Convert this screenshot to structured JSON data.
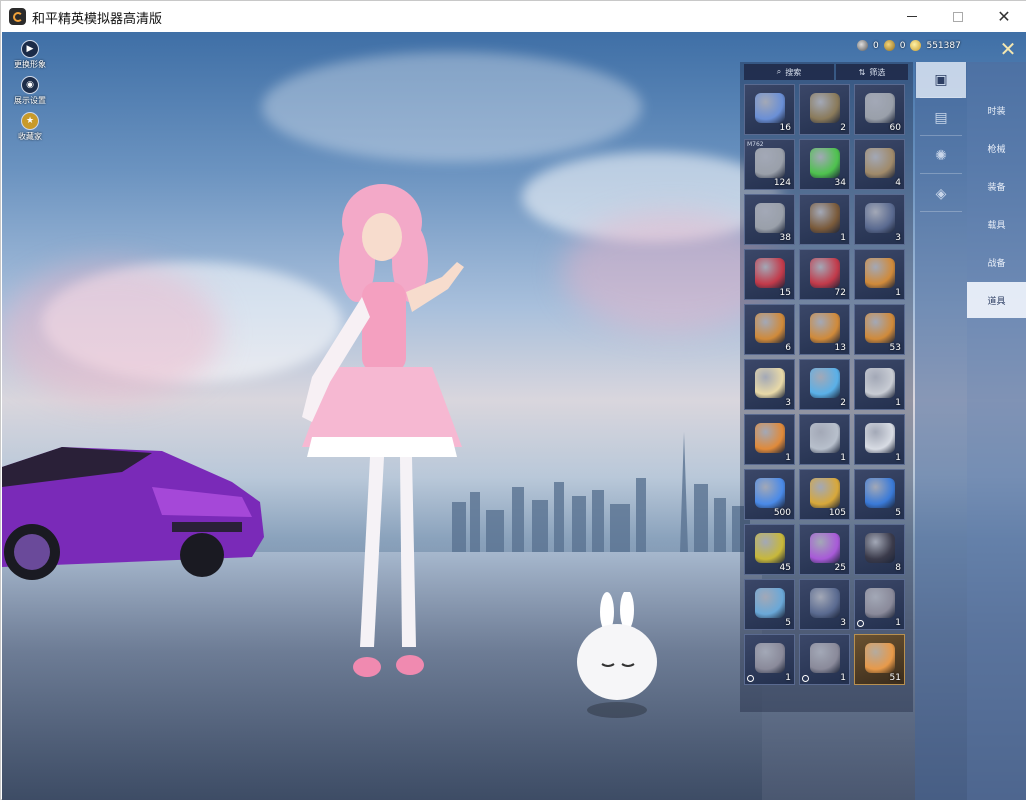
{
  "window": {
    "title": "和平精英模拟器高清版",
    "controls": {
      "minimize": "minimize",
      "maximize": "maximize",
      "close": "close"
    }
  },
  "left_tools": [
    {
      "icon": "play-icon",
      "label": "更换形象"
    },
    {
      "icon": "eye-icon",
      "label": "展示设置"
    },
    {
      "icon": "badge-icon",
      "label": "收藏家"
    }
  ],
  "currency": [
    {
      "icon": "silver-coin-icon",
      "value": "0"
    },
    {
      "icon": "gold-coin-icon",
      "value": "0"
    },
    {
      "icon": "yellow-coin-icon",
      "value": "551387"
    }
  ],
  "search": {
    "search_label": "搜索",
    "filter_label": "筛选"
  },
  "inventory": [
    {
      "name": "spray-can",
      "qty": "16",
      "tag": "",
      "clock": false,
      "color": "#6a8fd6"
    },
    {
      "name": "ammo-crate",
      "qty": "2",
      "tag": "",
      "clock": false,
      "color": "#8a7a5a"
    },
    {
      "name": "spring",
      "qty": "60",
      "tag": "",
      "clock": false,
      "color": "#9aa0aa"
    },
    {
      "name": "spring-m762",
      "qty": "124",
      "tag": "M762",
      "clock": false,
      "color": "#9aa0aa"
    },
    {
      "name": "green-battery",
      "qty": "34",
      "tag": "",
      "clock": false,
      "color": "#4ec24e"
    },
    {
      "name": "crate",
      "qty": "4",
      "tag": "",
      "clock": false,
      "color": "#a08a6a"
    },
    {
      "name": "spring",
      "qty": "38",
      "tag": "",
      "clock": false,
      "color": "#9aa0aa"
    },
    {
      "name": "id-card",
      "qty": "1",
      "tag": "",
      "clock": false,
      "color": "#7a5a3a"
    },
    {
      "name": "ticket-3x",
      "qty": "3",
      "tag": "",
      "clock": false,
      "color": "#5a6a90"
    },
    {
      "name": "ticket-3x",
      "qty": "15",
      "tag": "",
      "clock": false,
      "color": "#c23a4a"
    },
    {
      "name": "ticket-2x",
      "qty": "72",
      "tag": "",
      "clock": false,
      "color": "#c23a4a"
    },
    {
      "name": "ticket-3x-gold",
      "qty": "1",
      "tag": "",
      "clock": false,
      "color": "#d08a3a"
    },
    {
      "name": "ticket-1x-gold",
      "qty": "6",
      "tag": "",
      "clock": false,
      "color": "#d08a3a"
    },
    {
      "name": "ticket-3x-gold",
      "qty": "13",
      "tag": "",
      "clock": false,
      "color": "#d08a3a"
    },
    {
      "name": "ticket-2x-gold",
      "qty": "53",
      "tag": "",
      "clock": false,
      "color": "#d08a3a"
    },
    {
      "name": "compass",
      "qty": "3",
      "tag": "",
      "clock": false,
      "color": "#e8d9a8"
    },
    {
      "name": "blue-orb",
      "qty": "2",
      "tag": "",
      "clock": false,
      "color": "#5ab0e8"
    },
    {
      "name": "silver-coin",
      "qty": "1",
      "tag": "",
      "clock": false,
      "color": "#c8ccd4"
    },
    {
      "name": "orange-shield",
      "qty": "1",
      "tag": "",
      "clock": false,
      "color": "#e08a3a"
    },
    {
      "name": "silver-shield",
      "qty": "1",
      "tag": "",
      "clock": false,
      "color": "#b8c0cc"
    },
    {
      "name": "silver-key",
      "qty": "1",
      "tag": "",
      "clock": false,
      "color": "#d8dce4"
    },
    {
      "name": "blue-diamond",
      "qty": "500",
      "tag": "",
      "clock": false,
      "color": "#4a8ae8"
    },
    {
      "name": "gold-card",
      "qty": "105",
      "tag": "",
      "clock": false,
      "color": "#d8a83a"
    },
    {
      "name": "blue-card",
      "qty": "5",
      "tag": "",
      "clock": false,
      "color": "#3a7ad8"
    },
    {
      "name": "grenade",
      "qty": "45",
      "tag": "",
      "clock": false,
      "color": "#c8b83a"
    },
    {
      "name": "spray-paint",
      "qty": "25",
      "tag": "",
      "clock": false,
      "color": "#a85ad8"
    },
    {
      "name": "scope",
      "qty": "8",
      "tag": "",
      "clock": false,
      "color": "#3a3a4a"
    },
    {
      "name": "spray-gun",
      "qty": "5",
      "tag": "",
      "clock": false,
      "color": "#6aa8d8"
    },
    {
      "name": "gear-token",
      "qty": "3",
      "tag": "",
      "clock": false,
      "color": "#5a6a90"
    },
    {
      "name": "coupon",
      "qty": "1",
      "tag": "",
      "clock": true,
      "color": "#8a8a9a"
    },
    {
      "name": "coupon",
      "qty": "1",
      "tag": "",
      "clock": true,
      "color": "#8a8a9a"
    },
    {
      "name": "coupon",
      "qty": "1",
      "tag": "",
      "clock": true,
      "color": "#8a8a9a"
    },
    {
      "name": "gold-emblem",
      "qty": "51",
      "tag": "",
      "clock": false,
      "color": "#e89a4a",
      "gold": true
    }
  ],
  "category_icons": [
    {
      "icon": "card-icon",
      "active": true
    },
    {
      "icon": "chest-icon",
      "active": false
    },
    {
      "icon": "firework-icon",
      "active": false
    },
    {
      "icon": "ticket-icon",
      "active": false
    }
  ],
  "tabs": [
    {
      "label": "时装",
      "active": false
    },
    {
      "label": "枪械",
      "active": false
    },
    {
      "label": "装备",
      "active": false
    },
    {
      "label": "载具",
      "active": false
    },
    {
      "label": "战备",
      "active": false
    },
    {
      "label": "道具",
      "active": true
    }
  ]
}
